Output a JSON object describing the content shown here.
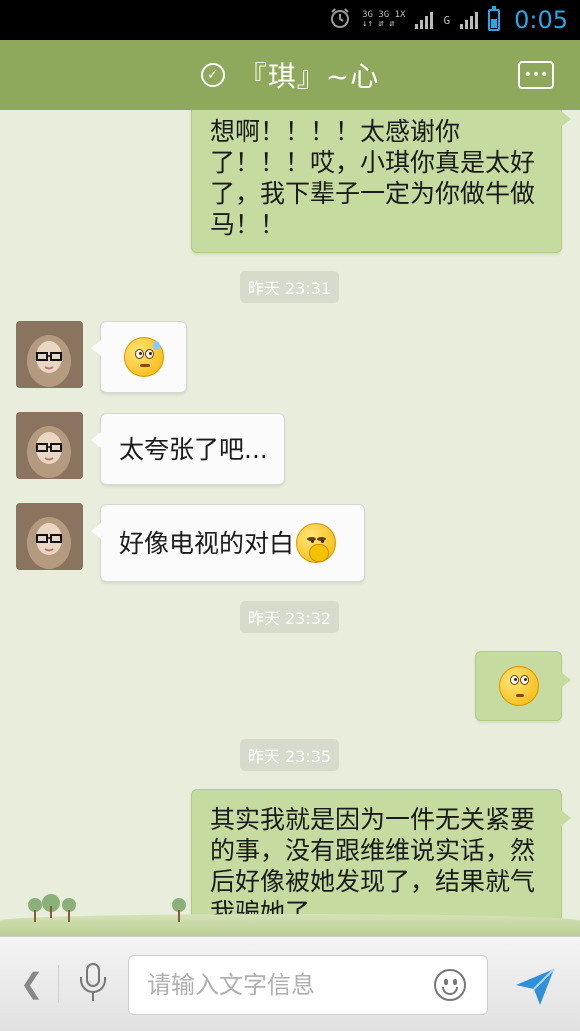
{
  "status_bar": {
    "time": "0:05",
    "network_top": "3G 3G 1X",
    "network_bottom": "↓↑ ⇵ ⇵",
    "signal_letter": "G",
    "battery_level": 0.5
  },
  "header": {
    "title": "『琪』~心"
  },
  "messages": [
    {
      "side": "right",
      "type": "text",
      "text": "想啊！！！！太感谢你了！！！哎，小琪你真是太好了，我下辈子一定为你做牛做马！！"
    },
    {
      "type": "timestamp",
      "text": "昨天 23:31"
    },
    {
      "side": "left",
      "type": "emoji",
      "emoji": "sweat-face"
    },
    {
      "side": "left",
      "type": "text",
      "text": "太夸张了吧..."
    },
    {
      "side": "left",
      "type": "text",
      "text": "好像电视的对白",
      "emoji": "hand-over-mouth-face"
    },
    {
      "type": "timestamp",
      "text": "昨天 23:32"
    },
    {
      "side": "right",
      "type": "emoji",
      "emoji": "rolling-eyes-face"
    },
    {
      "type": "timestamp",
      "text": "昨天 23:35"
    },
    {
      "side": "right",
      "type": "text",
      "text": "其实我就是因为一件无关紧要的事，没有跟维维说实话，然后好像被她发现了，结果就气我骗她了"
    }
  ],
  "input_bar": {
    "placeholder": "请输入文字信息",
    "back_icon": "chevron-left-icon",
    "mic_icon": "microphone-icon",
    "emoji_icon": "smiley-icon",
    "send_icon": "send-plane-icon"
  },
  "colors": {
    "header_bg": "#8ea95c",
    "chat_bg": "#e8eedb",
    "right_bubble": "#c6dba0",
    "left_bubble": "#fbfbfb",
    "accent": "#2aa5e6"
  }
}
